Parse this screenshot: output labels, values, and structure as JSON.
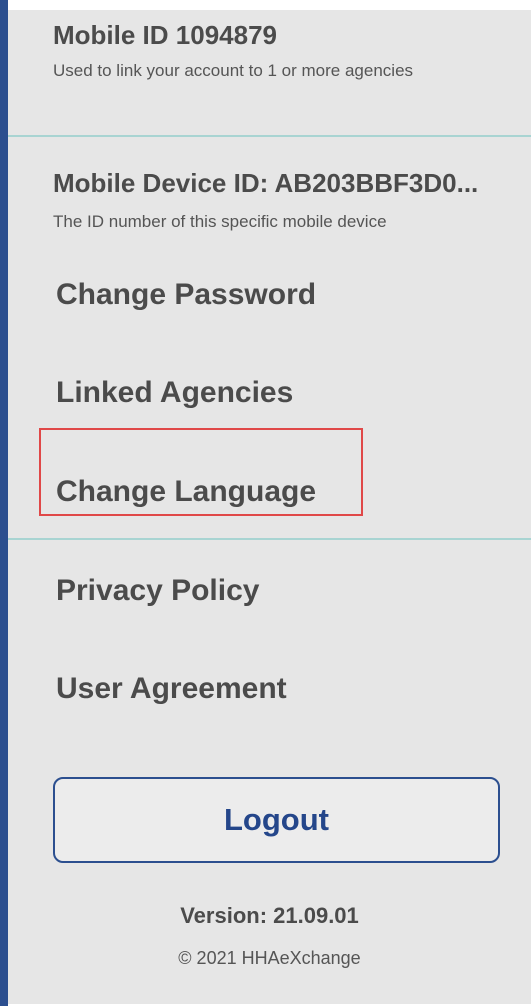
{
  "account": {
    "mobile_id_title": "Mobile ID 1094879",
    "mobile_id_desc": "Used to link your account to 1 or more agencies",
    "device_id_title": "Mobile Device ID: AB203BBF3D0...",
    "device_id_desc": "The ID number of this specific mobile device"
  },
  "menu": {
    "change_password": "Change Password",
    "linked_agencies": "Linked Agencies",
    "change_language": "Change Language",
    "privacy_policy": "Privacy Policy",
    "user_agreement": "User Agreement"
  },
  "logout_label": "Logout",
  "footer": {
    "version": "Version: 21.09.01",
    "copyright": "© 2021 HHAeXchange"
  },
  "colors": {
    "accent_blue": "#2c4f8f",
    "highlight_red": "#e04848",
    "divider_teal": "#a8d4d2",
    "panel_bg": "#e6e6e6"
  }
}
